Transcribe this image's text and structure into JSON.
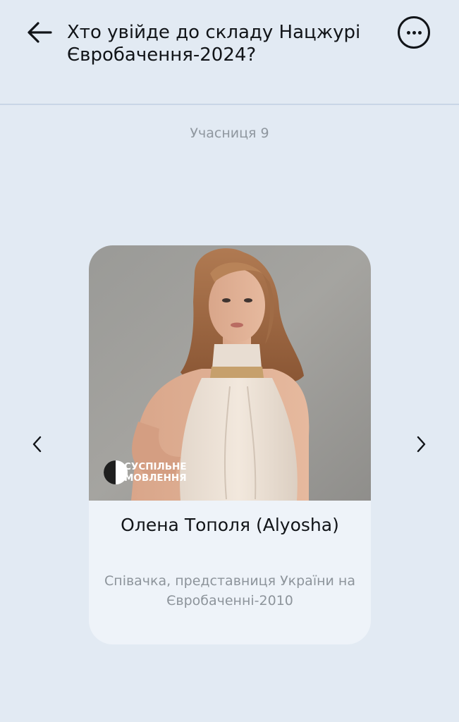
{
  "header": {
    "title": "Хто увійде до складу Нацжурі Євробачення-2024?",
    "back_icon": "arrow-left-icon",
    "more_icon": "more-horizontal-icon"
  },
  "counter": {
    "label": "Учасниця 9"
  },
  "card": {
    "name": "Олена Тополя (Alyosha)",
    "description": "Співачка, представниця України на Євробаченні-2010",
    "logo": {
      "line1": "СУСПІЛЬНЕ",
      "line2": "МОВЛЕННЯ"
    }
  },
  "navigation": {
    "prev_icon": "chevron-left-icon",
    "next_icon": "chevron-right-icon"
  },
  "colors": {
    "background": "#e2eaf3",
    "card_background": "#eef3f9",
    "primary_text": "#111418",
    "secondary_text": "#8d949b",
    "divider": "#c9d6e6"
  }
}
